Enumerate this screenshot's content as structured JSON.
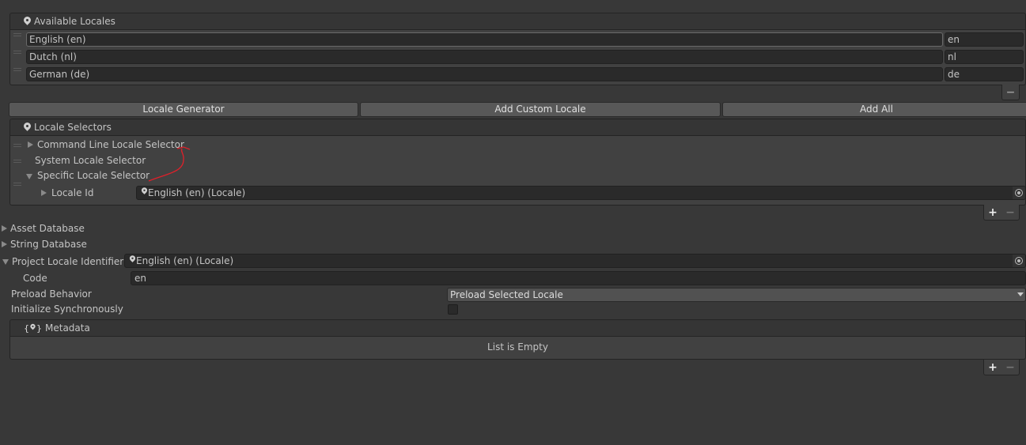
{
  "available_locales": {
    "title": "Available Locales",
    "items": [
      {
        "name": "English (en)",
        "code": "en"
      },
      {
        "name": "Dutch (nl)",
        "code": "nl"
      },
      {
        "name": "German (de)",
        "code": "de"
      }
    ],
    "remove_label": "−"
  },
  "buttons": {
    "locale_generator": "Locale Generator",
    "add_custom_locale": "Add Custom Locale",
    "add_all": "Add All"
  },
  "locale_selectors": {
    "title": "Locale Selectors",
    "items": [
      "Command Line Locale Selector",
      "System Locale Selector",
      "Specific Locale Selector"
    ],
    "locale_id_label": "Locale Id",
    "locale_id_value": "English (en) (Locale)",
    "add_label": "+",
    "remove_label": "−"
  },
  "settings": {
    "asset_database": "Asset Database",
    "string_database": "String Database",
    "project_locale_label": "Project Locale Identifier",
    "project_locale_value": "English (en) (Locale)",
    "code_label": "Code",
    "code_value": "en",
    "preload_label": "Preload Behavior",
    "preload_value": "Preload Selected Locale",
    "init_sync_label": "Initialize Synchronously",
    "init_sync_checked": false
  },
  "metadata": {
    "title": "Metadata",
    "empty": "List is Empty",
    "add_label": "+",
    "remove_label": "−"
  },
  "colors": {
    "annotation": "#e0202a"
  }
}
